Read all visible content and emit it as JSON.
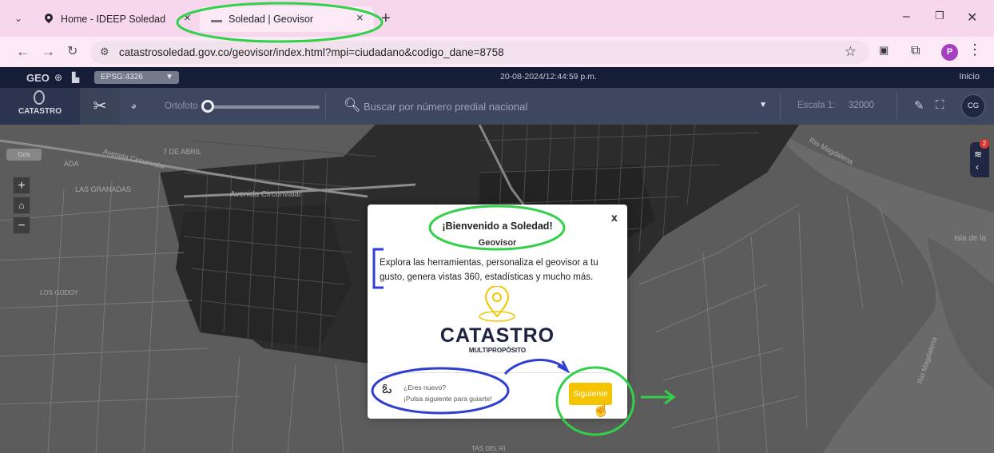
{
  "browser": {
    "tabs": [
      {
        "title": "Home - IDEEP Soledad",
        "icon": "map-pin-icon"
      },
      {
        "title": "Soledad | Geovisor",
        "icon": "site-favicon",
        "active": true
      }
    ],
    "url": "catastrosoledad.gov.co/geovisor/index.html?mpi=ciudadano&codigo_dane=8758",
    "profile_initial": "P",
    "profile_color": "#a53fc0"
  },
  "app": {
    "logo": "GEO",
    "crs": "EPSG:4326",
    "datetime": "20-08-2024/12:44:59 p.m.",
    "home_link": "Inicio",
    "brand": "CATASTRO",
    "ortofoto_label": "Ortofoto",
    "ortofoto_opacity": 0,
    "search_placeholder": "Buscar por número predial nacional",
    "scale_label": "Escala 1:",
    "scale_value": "32000",
    "user_initials": "CG",
    "basemap_label": "Gris",
    "layers_badge": "2",
    "accent_color": "#f5c400",
    "nav_color": "#161d36"
  },
  "map_labels": [
    "7 DE ABRIL",
    "Avenida Circunvalar",
    "Avenida Circunvalar",
    "LAS GRANADAS",
    "LOS GODOY",
    "Rio Magdalena",
    "Isla de la",
    "Rio Magdalena",
    "TAS DEL RI",
    "ADA"
  ],
  "modal": {
    "title": "¡Bienvenido a Soledad!",
    "subtitle": "Geovisor",
    "body": "Explora las herramientas, personaliza el geovisor a tu gusto, genera vistas 360, estadísticas y mucho más.",
    "brand": "CATASTRO",
    "brand_sub": "MULTIPROPÓSITO",
    "question": "¿Eres nuevo?",
    "hint": "¡Pulsa siguiente para guiarte!",
    "next_label": "Siguiente",
    "close_label": "x"
  }
}
